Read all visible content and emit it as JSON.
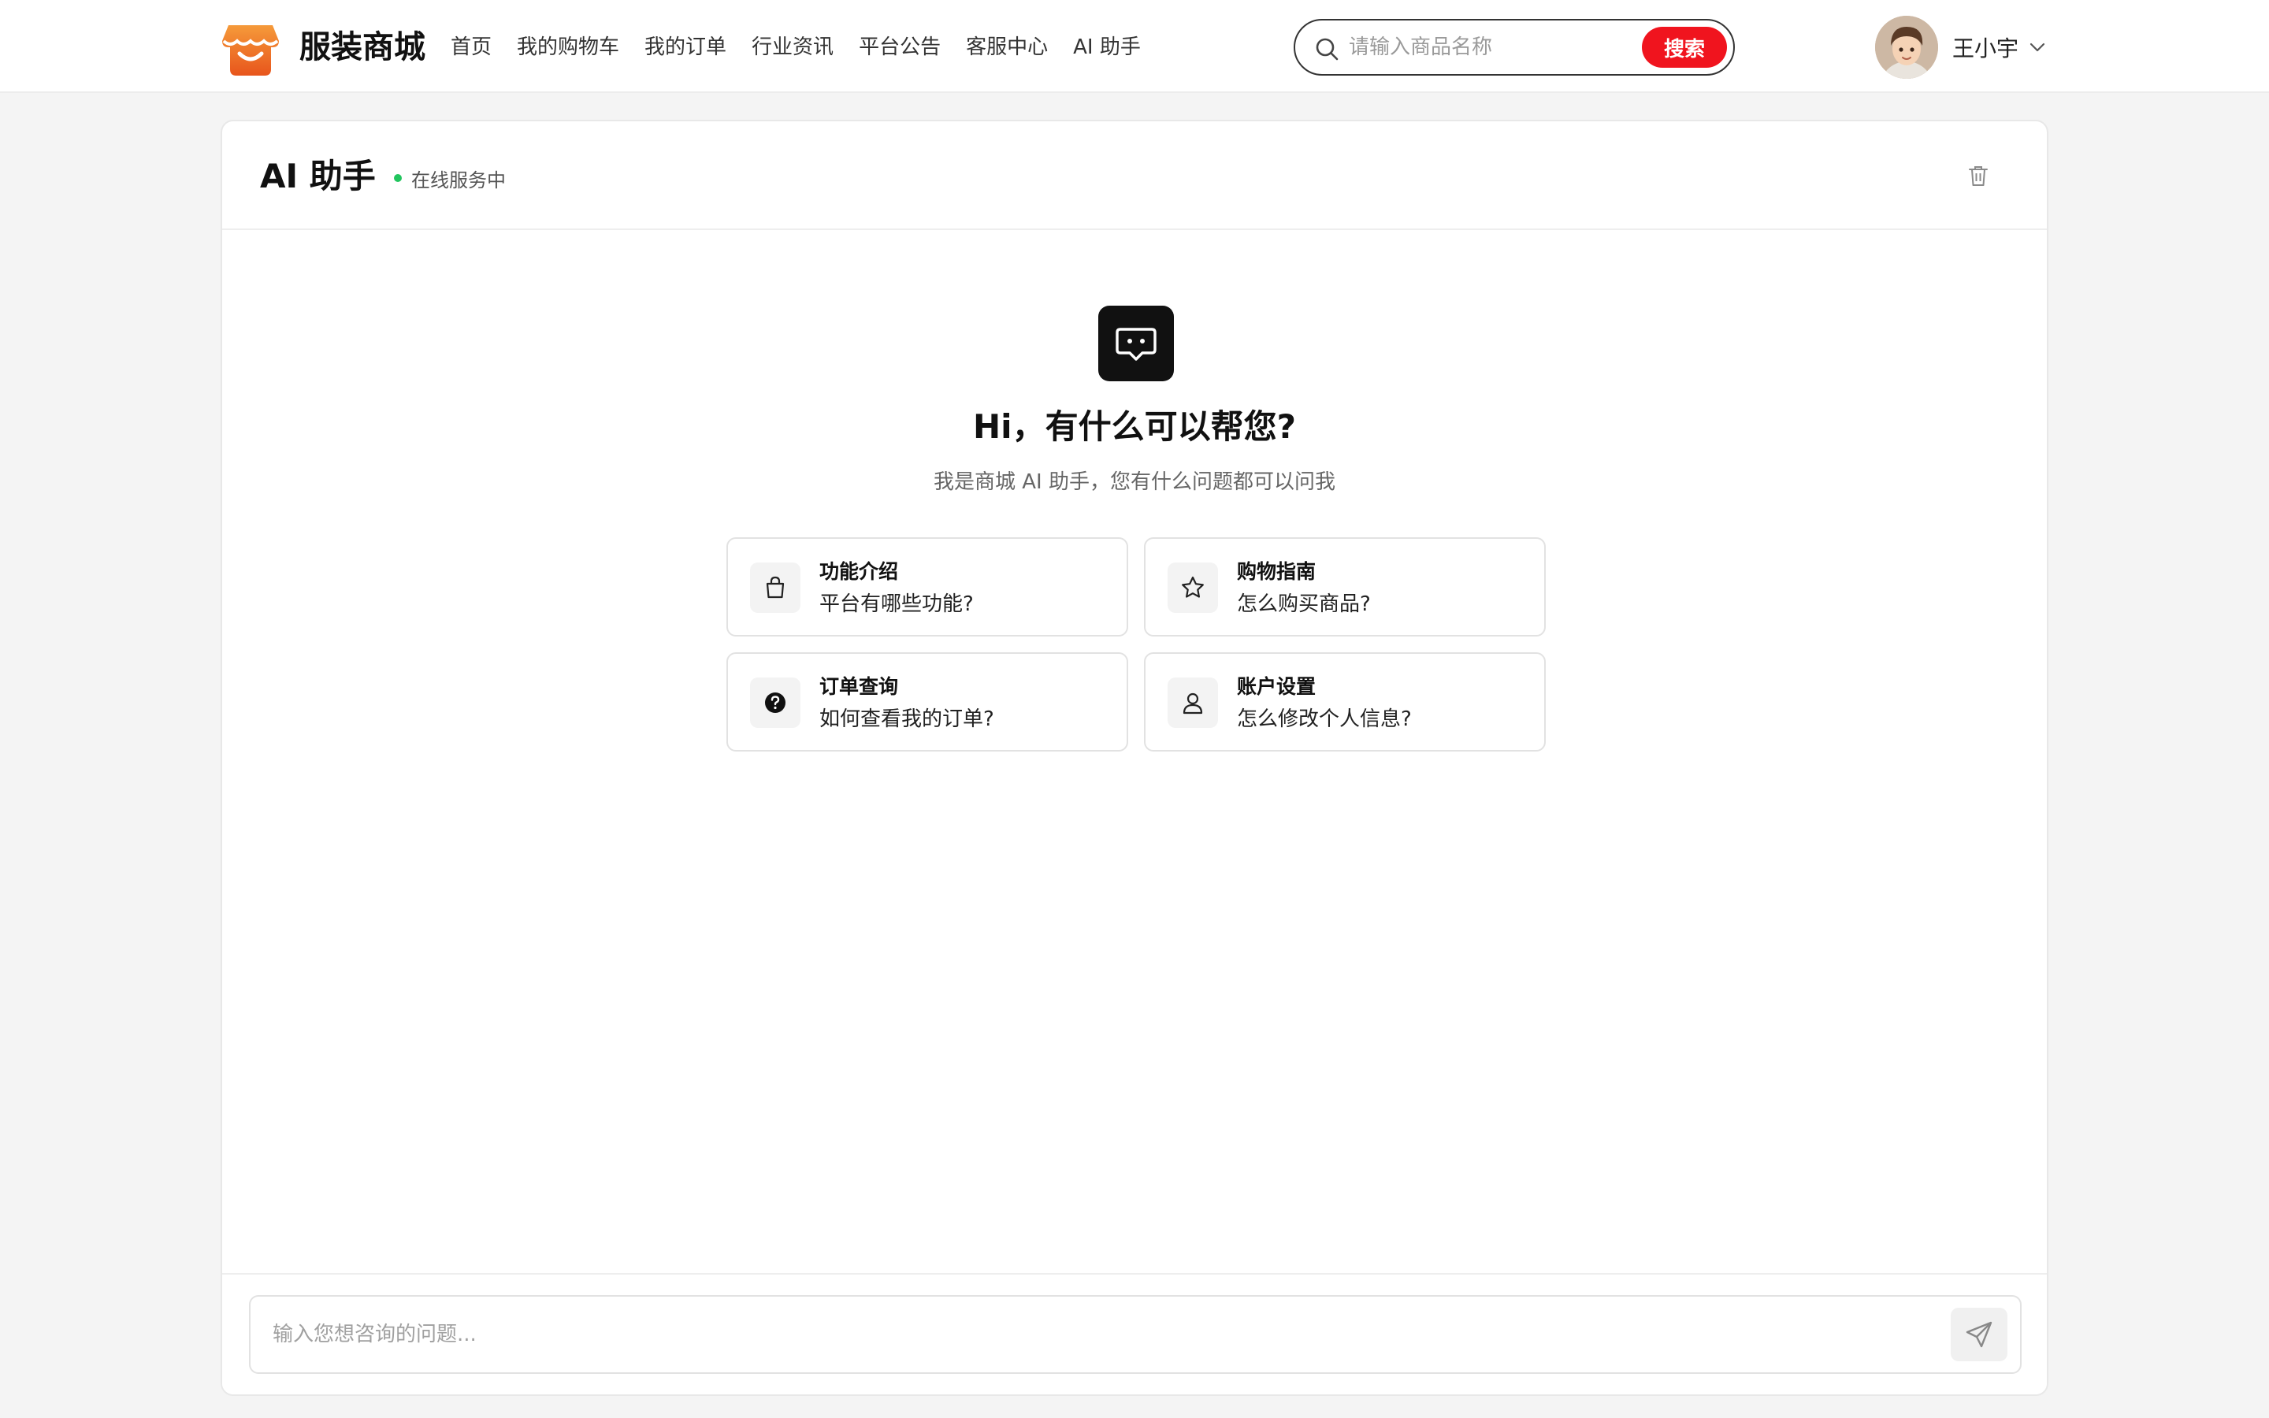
{
  "brand": {
    "name": "服装商城",
    "logo_icon": "shop-icon",
    "accent": "#f08a24"
  },
  "nav": {
    "items": [
      "首页",
      "我的购物车",
      "我的订单",
      "行业资讯",
      "平台公告",
      "客服中心",
      "AI 助手"
    ]
  },
  "search": {
    "placeholder": "请输入商品名称",
    "value": "",
    "button_label": "搜索",
    "button_color": "#f0141e"
  },
  "user": {
    "name": "王小宇"
  },
  "chat": {
    "title": "AI 助手",
    "status": "在线服务中",
    "status_color": "#22c55e",
    "welcome_title": "Hi，有什么可以帮您?",
    "welcome_subtitle": "我是商城 AI 助手，您有什么问题都可以问我",
    "suggestions": [
      {
        "title": "功能介绍",
        "desc": "平台有哪些功能?",
        "icon": "shopping-bag-icon"
      },
      {
        "title": "购物指南",
        "desc": "怎么购买商品?",
        "icon": "star-icon"
      },
      {
        "title": "订单查询",
        "desc": "如何查看我的订单?",
        "icon": "question-icon"
      },
      {
        "title": "账户设置",
        "desc": "怎么修改个人信息?",
        "icon": "user-icon"
      }
    ],
    "input_placeholder": "输入您想咨询的问题...",
    "input_value": ""
  }
}
